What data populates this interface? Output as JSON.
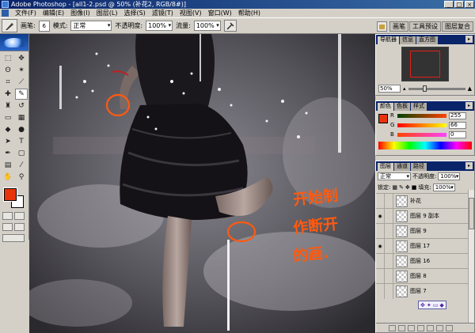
{
  "window": {
    "title": "Adobe Photoshop - [all1-2.psd @ 50% (补花2, RGB/8#)]",
    "buttons": [
      "_",
      "□",
      "×"
    ]
  },
  "menu": [
    "文件(F)",
    "编辑(E)",
    "图像(I)",
    "图层(L)",
    "选择(S)",
    "滤镜(T)",
    "视图(V)",
    "窗口(W)",
    "帮助(H)"
  ],
  "options": {
    "brush_label": "画笔:",
    "brush_size": "6",
    "mode_label": "模式:",
    "mode_value": "正常",
    "opacity_label": "不透明度:",
    "opacity_value": "100%",
    "flow_label": "流量:",
    "flow_value": "100%",
    "top_tabs": [
      "画笔",
      "工具预设",
      "图层复合"
    ]
  },
  "navigator": {
    "tabs": [
      "导航器",
      "信息",
      "直方图"
    ],
    "zoom": "50%"
  },
  "color_panel": {
    "tabs": [
      "颜色",
      "色板",
      "样式"
    ],
    "channels": [
      {
        "label": "R",
        "value": "255"
      },
      {
        "label": "G",
        "value": "66"
      },
      {
        "label": "B",
        "value": "0"
      }
    ],
    "foreground": "#e8340c"
  },
  "layers_panel": {
    "tabs": [
      "图层",
      "通道",
      "路径"
    ],
    "blend_mode": "正常",
    "opacity_label": "不透明度:",
    "opacity_value": "100%",
    "lock_label": "锁定:",
    "fill_label": "填充:",
    "fill_value": "100%",
    "layers": [
      {
        "name": "补花",
        "visible": false
      },
      {
        "name": "图层 9 副本",
        "visible": true
      },
      {
        "name": "图层 9",
        "visible": false
      },
      {
        "name": "图层 17",
        "visible": true
      },
      {
        "name": "图层 16",
        "visible": false
      },
      {
        "name": "图层 8",
        "visible": false
      },
      {
        "name": "图层 7",
        "visible": false
      }
    ]
  },
  "annotation": {
    "lines": [
      "开始制",
      "作断开",
      "的画."
    ],
    "color": "#ff5a10"
  }
}
